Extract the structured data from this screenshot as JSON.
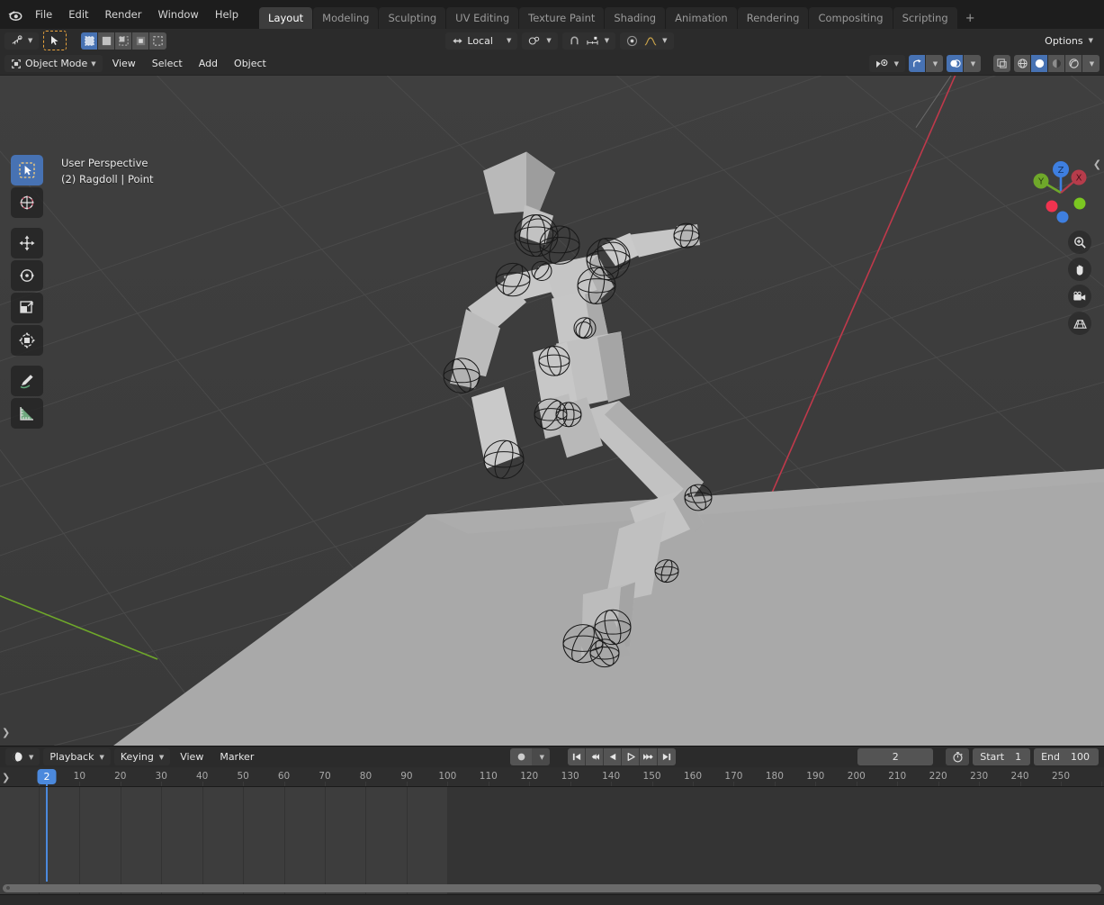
{
  "app": {
    "title": "Blender",
    "accent": "#4772b3",
    "viewport_bg": "#3d3d3d",
    "ground_color": "#a8a8a8"
  },
  "topbar": {
    "logo_icon": "blender-logo-icon",
    "menus": [
      "File",
      "Edit",
      "Render",
      "Window",
      "Help"
    ],
    "workspaces": [
      {
        "label": "Layout",
        "active": true
      },
      {
        "label": "Modeling",
        "active": false
      },
      {
        "label": "Sculpting",
        "active": false
      },
      {
        "label": "UV Editing",
        "active": false
      },
      {
        "label": "Texture Paint",
        "active": false
      },
      {
        "label": "Shading",
        "active": false
      },
      {
        "label": "Animation",
        "active": false
      },
      {
        "label": "Rendering",
        "active": false
      },
      {
        "label": "Compositing",
        "active": false
      },
      {
        "label": "Scripting",
        "active": false
      }
    ],
    "add_workspace_label": "+"
  },
  "tool_header": {
    "editor_type_icon": "editor-type-icon",
    "active_tool_icon": "select-box-tool-icon",
    "select_modes": [
      {
        "name": "set",
        "icon": "select-set-icon",
        "active": true
      },
      {
        "name": "extend",
        "icon": "select-extend-icon",
        "active": false
      },
      {
        "name": "subtract",
        "icon": "select-subtract-icon",
        "active": false
      },
      {
        "name": "invert",
        "icon": "select-invert-icon",
        "active": false
      },
      {
        "name": "intersect",
        "icon": "select-intersect-icon",
        "active": false
      }
    ],
    "transform_orientation": "Local",
    "pivot_icon": "pivot-point-icon",
    "snap_icon": "snap-magnet-icon",
    "snap_to_icon": "snap-increment-icon",
    "proportional_icon": "proportional-editing-icon",
    "falloff_icon": "proportional-falloff-icon",
    "options_label": "Options"
  },
  "mode_header": {
    "mode_icon": "object-mode-icon",
    "mode_label": "Object Mode",
    "menus": [
      "View",
      "Select",
      "Add",
      "Object"
    ],
    "right_icons": [
      {
        "name": "visibility-icon",
        "active": false
      },
      {
        "name": "gizmo-icon",
        "active": true
      },
      {
        "name": "overlays-icon",
        "active": true
      },
      {
        "name": "xray-toggle-icon",
        "active": false
      }
    ],
    "shading_modes": [
      {
        "name": "wireframe-shading-icon",
        "active": false
      },
      {
        "name": "solid-shading-icon",
        "active": true
      },
      {
        "name": "material-preview-shading-icon",
        "active": false
      },
      {
        "name": "rendered-shading-icon",
        "active": false
      }
    ]
  },
  "viewport": {
    "perspective_label": "User Perspective",
    "scene_info": "(2) Ragdoll | Point",
    "tools": [
      {
        "name": "tweak-select-box-tool",
        "icon": "select-box-icon",
        "active": true
      },
      {
        "name": "cursor-tool",
        "icon": "cursor-3d-icon",
        "active": false
      },
      {
        "name": "move-tool",
        "icon": "move-icon",
        "active": false
      },
      {
        "name": "rotate-tool",
        "icon": "rotate-icon",
        "active": false
      },
      {
        "name": "scale-tool",
        "icon": "scale-icon",
        "active": false
      },
      {
        "name": "transform-tool",
        "icon": "transform-icon",
        "active": false
      },
      {
        "name": "annotate-tool",
        "icon": "annotate-pencil-icon",
        "active": false
      },
      {
        "name": "measure-tool",
        "icon": "measure-ruler-icon",
        "active": false
      }
    ],
    "gizmo": {
      "axes": [
        {
          "label": "Z",
          "color": "#3e7fe0"
        },
        {
          "label": "X",
          "color": "#b63c4b"
        },
        {
          "label": "Y",
          "color": "#6fa82a"
        }
      ]
    },
    "nav_buttons": [
      {
        "name": "zoom-nav-icon"
      },
      {
        "name": "pan-hand-icon"
      },
      {
        "name": "camera-view-icon"
      },
      {
        "name": "toggle-orthographic-icon"
      }
    ],
    "collapse_right_icon": "chevron-left-icon",
    "collapse_left_icon": "chevron-right-icon"
  },
  "timeline": {
    "editor_icon": "timeline-editor-icon",
    "menus": [
      {
        "label": "Playback",
        "dropdown": true
      },
      {
        "label": "Keying",
        "dropdown": true
      },
      {
        "label": "View",
        "dropdown": false
      },
      {
        "label": "Marker",
        "dropdown": false
      }
    ],
    "auto_key_icon": "record-auto-key-icon",
    "playback_buttons": [
      {
        "name": "jump-to-start-button",
        "icon": "jump-start-icon"
      },
      {
        "name": "previous-keyframe-button",
        "icon": "prev-keyframe-icon"
      },
      {
        "name": "play-reverse-button",
        "icon": "play-reverse-icon"
      },
      {
        "name": "play-button",
        "icon": "play-icon"
      },
      {
        "name": "next-keyframe-button",
        "icon": "next-keyframe-icon"
      },
      {
        "name": "jump-to-end-button",
        "icon": "jump-end-icon"
      }
    ],
    "current_frame": "2",
    "use_preview_range_icon": "stopwatch-icon",
    "start_label": "Start",
    "start_value": "1",
    "end_label": "End",
    "end_value": "100",
    "ruler_ticks": [
      "10",
      "20",
      "30",
      "40",
      "50",
      "60",
      "70",
      "80",
      "90",
      "100",
      "110",
      "120",
      "130",
      "140",
      "150",
      "160",
      "170",
      "180",
      "190",
      "200",
      "210",
      "220",
      "230",
      "240",
      "250"
    ],
    "playhead_frame_label": "2",
    "frame_range_start": 1,
    "frame_range_end": 100
  }
}
